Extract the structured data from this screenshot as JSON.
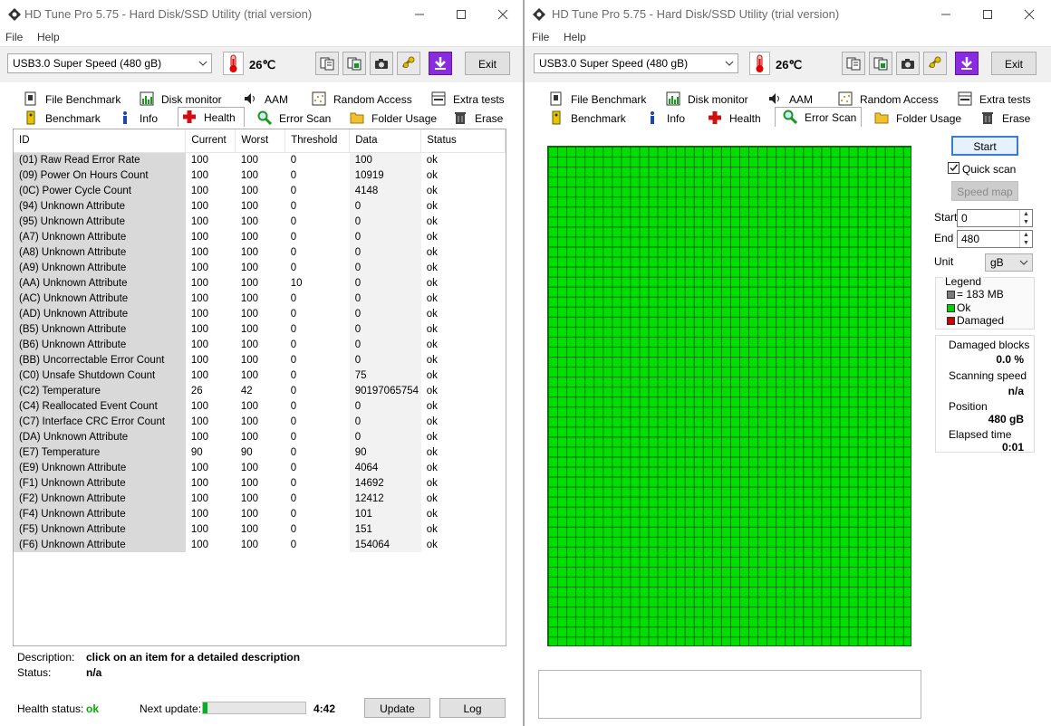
{
  "app": {
    "title": "HD Tune Pro 5.75 - Hard Disk/SSD Utility (trial version)",
    "menu": [
      "File",
      "Help"
    ],
    "drive": "USB3.0  Super Speed (480 gB)",
    "temperature": "26℃",
    "exit_label": "Exit",
    "tabs_row1": [
      "File Benchmark",
      "Disk monitor",
      "AAM",
      "Random Access",
      "Extra tests"
    ],
    "tabs_row2": [
      "Benchmark",
      "Info",
      "Health",
      "Error Scan",
      "Folder Usage",
      "Erase"
    ],
    "toolbar_icons": [
      "copy-text-icon",
      "copy-screenshot-icon",
      "camera-icon",
      "options-icon",
      "download-icon"
    ],
    "colors": {
      "accent": "#3a7bd5",
      "ok_green": "#00b000",
      "grid_green": "#00e000",
      "damaged_red": "#cc0000",
      "health_cross": "#d01010"
    }
  },
  "left": {
    "active_tab": "Health",
    "table": {
      "headers": [
        "ID",
        "Current",
        "Worst",
        "Threshold",
        "Data",
        "Status"
      ],
      "rows": [
        [
          "(01) Raw Read Error Rate",
          "100",
          "100",
          "0",
          "100",
          "ok"
        ],
        [
          "(09) Power On Hours Count",
          "100",
          "100",
          "0",
          "10919",
          "ok"
        ],
        [
          "(0C) Power Cycle Count",
          "100",
          "100",
          "0",
          "4148",
          "ok"
        ],
        [
          "(94) Unknown Attribute",
          "100",
          "100",
          "0",
          "0",
          "ok"
        ],
        [
          "(95) Unknown Attribute",
          "100",
          "100",
          "0",
          "0",
          "ok"
        ],
        [
          "(A7) Unknown Attribute",
          "100",
          "100",
          "0",
          "0",
          "ok"
        ],
        [
          "(A8) Unknown Attribute",
          "100",
          "100",
          "0",
          "0",
          "ok"
        ],
        [
          "(A9) Unknown Attribute",
          "100",
          "100",
          "0",
          "0",
          "ok"
        ],
        [
          "(AA) Unknown Attribute",
          "100",
          "100",
          "10",
          "0",
          "ok"
        ],
        [
          "(AC) Unknown Attribute",
          "100",
          "100",
          "0",
          "0",
          "ok"
        ],
        [
          "(AD) Unknown Attribute",
          "100",
          "100",
          "0",
          "0",
          "ok"
        ],
        [
          "(B5) Unknown Attribute",
          "100",
          "100",
          "0",
          "0",
          "ok"
        ],
        [
          "(B6) Unknown Attribute",
          "100",
          "100",
          "0",
          "0",
          "ok"
        ],
        [
          "(BB) Uncorrectable Error Count",
          "100",
          "100",
          "0",
          "0",
          "ok"
        ],
        [
          "(C0) Unsafe Shutdown Count",
          "100",
          "100",
          "0",
          "75",
          "ok"
        ],
        [
          "(C2) Temperature",
          "26",
          "42",
          "0",
          "90197065754",
          "ok"
        ],
        [
          "(C4) Reallocated Event Count",
          "100",
          "100",
          "0",
          "0",
          "ok"
        ],
        [
          "(C7) Interface CRC Error Count",
          "100",
          "100",
          "0",
          "0",
          "ok"
        ],
        [
          "(DA) Unknown Attribute",
          "100",
          "100",
          "0",
          "0",
          "ok"
        ],
        [
          "(E7) Temperature",
          "90",
          "90",
          "0",
          "90",
          "ok"
        ],
        [
          "(E9) Unknown Attribute",
          "100",
          "100",
          "0",
          "4064",
          "ok"
        ],
        [
          "(F1) Unknown Attribute",
          "100",
          "100",
          "0",
          "14692",
          "ok"
        ],
        [
          "(F2) Unknown Attribute",
          "100",
          "100",
          "0",
          "12412",
          "ok"
        ],
        [
          "(F4) Unknown Attribute",
          "100",
          "100",
          "0",
          "101",
          "ok"
        ],
        [
          "(F5) Unknown Attribute",
          "100",
          "100",
          "0",
          "151",
          "ok"
        ],
        [
          "(F6) Unknown Attribute",
          "100",
          "100",
          "0",
          "154064",
          "ok"
        ]
      ]
    },
    "description_label": "Description:",
    "description_value": "click on an item for a detailed description",
    "status_label": "Status:",
    "status_value": "n/a",
    "health_status_label": "Health status:",
    "health_status_value": "ok",
    "next_update_label": "Next update:",
    "next_update_progress": 0.04,
    "next_update_time": "4:42",
    "update_button": "Update",
    "log_button": "Log"
  },
  "right": {
    "active_tab": "Error Scan",
    "start_button": "Start",
    "quick_scan_label": "Quick scan",
    "quick_scan_checked": true,
    "speed_map_button": "Speed map",
    "start_label": "Start",
    "start_value": "0",
    "end_label": "End",
    "end_value": "480",
    "unit_label": "Unit",
    "unit_value": "gB",
    "legend_title": "Legend",
    "legend_block": "= 183 MB",
    "legend_ok": "Ok",
    "legend_damaged": "Damaged",
    "damaged_blocks_label": "Damaged blocks",
    "damaged_blocks_value": "0.0 %",
    "scanning_speed_label": "Scanning speed",
    "scanning_speed_value": "n/a",
    "position_label": "Position",
    "position_value": "480 gB",
    "elapsed_label": "Elapsed time",
    "elapsed_value": "0:01"
  }
}
